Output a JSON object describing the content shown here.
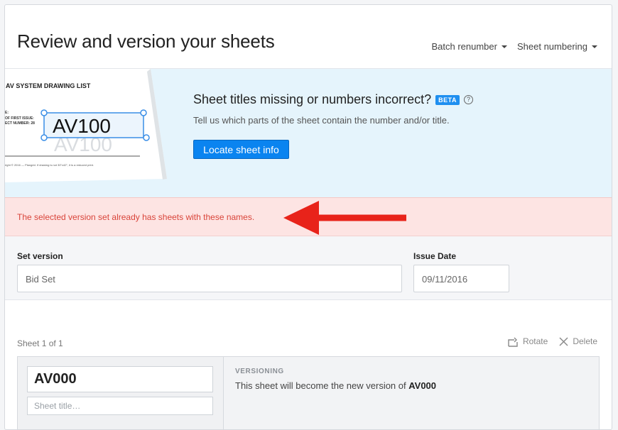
{
  "header": {
    "title": "Review and version your sheets",
    "batch_renumber": "Batch renumber",
    "sheet_numbering": "Sheet numbering"
  },
  "banner": {
    "image_caption": "AV SYSTEM DRAWING LIST",
    "image_number": "AV100",
    "title": "Sheet titles missing or numbers incorrect?",
    "badge": "BETA",
    "help": "?",
    "description": "Tell us which parts of the sheet contain the number and/or title.",
    "button_label": "Locate sheet info"
  },
  "error": {
    "message": "The selected version set already has sheets with these names."
  },
  "form": {
    "set_version_label": "Set version",
    "set_version_value": "Bid Set",
    "issue_date_label": "Issue Date",
    "issue_date_value": "09/11/2016"
  },
  "sheets": {
    "count_text": "Sheet 1 of 1",
    "rotate_label": "Rotate",
    "delete_label": "Delete",
    "items": [
      {
        "number": "AV000",
        "title_placeholder": "Sheet title…",
        "versioning_label": "VERSIONING",
        "versioning_text": "This sheet will become the new version of ",
        "versioning_target": "AV000"
      }
    ]
  },
  "colors": {
    "accent": "#0a84f0",
    "banner_bg": "#e5f4fc",
    "error_bg": "#fde4e3",
    "error_text": "#d9443a",
    "arrow": "#e8231a"
  }
}
